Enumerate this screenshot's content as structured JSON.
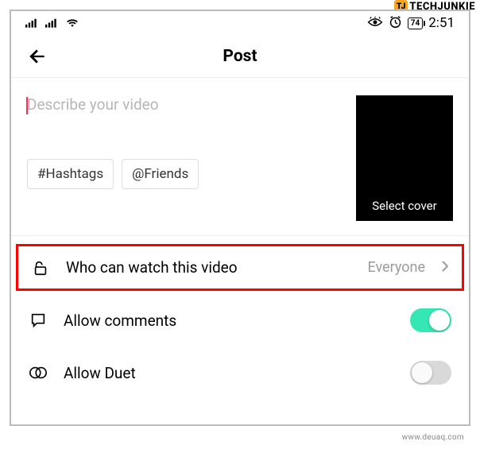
{
  "watermark": {
    "top": "TECHJUNKIE",
    "badge": "TJ",
    "bottom": "www.deuaq.com"
  },
  "statusbar": {
    "battery": "74",
    "time": "2:51"
  },
  "nav": {
    "title": "Post"
  },
  "compose": {
    "placeholder": "Describe your video",
    "chip_hashtags": "#Hashtags",
    "chip_friends": "@Friends",
    "cover_label": "Select cover"
  },
  "settings": {
    "privacy": {
      "label": "Who can watch this video",
      "value": "Everyone"
    },
    "comments": {
      "label": "Allow comments",
      "on": true
    },
    "duet": {
      "label": "Allow Duet",
      "on": false
    }
  }
}
